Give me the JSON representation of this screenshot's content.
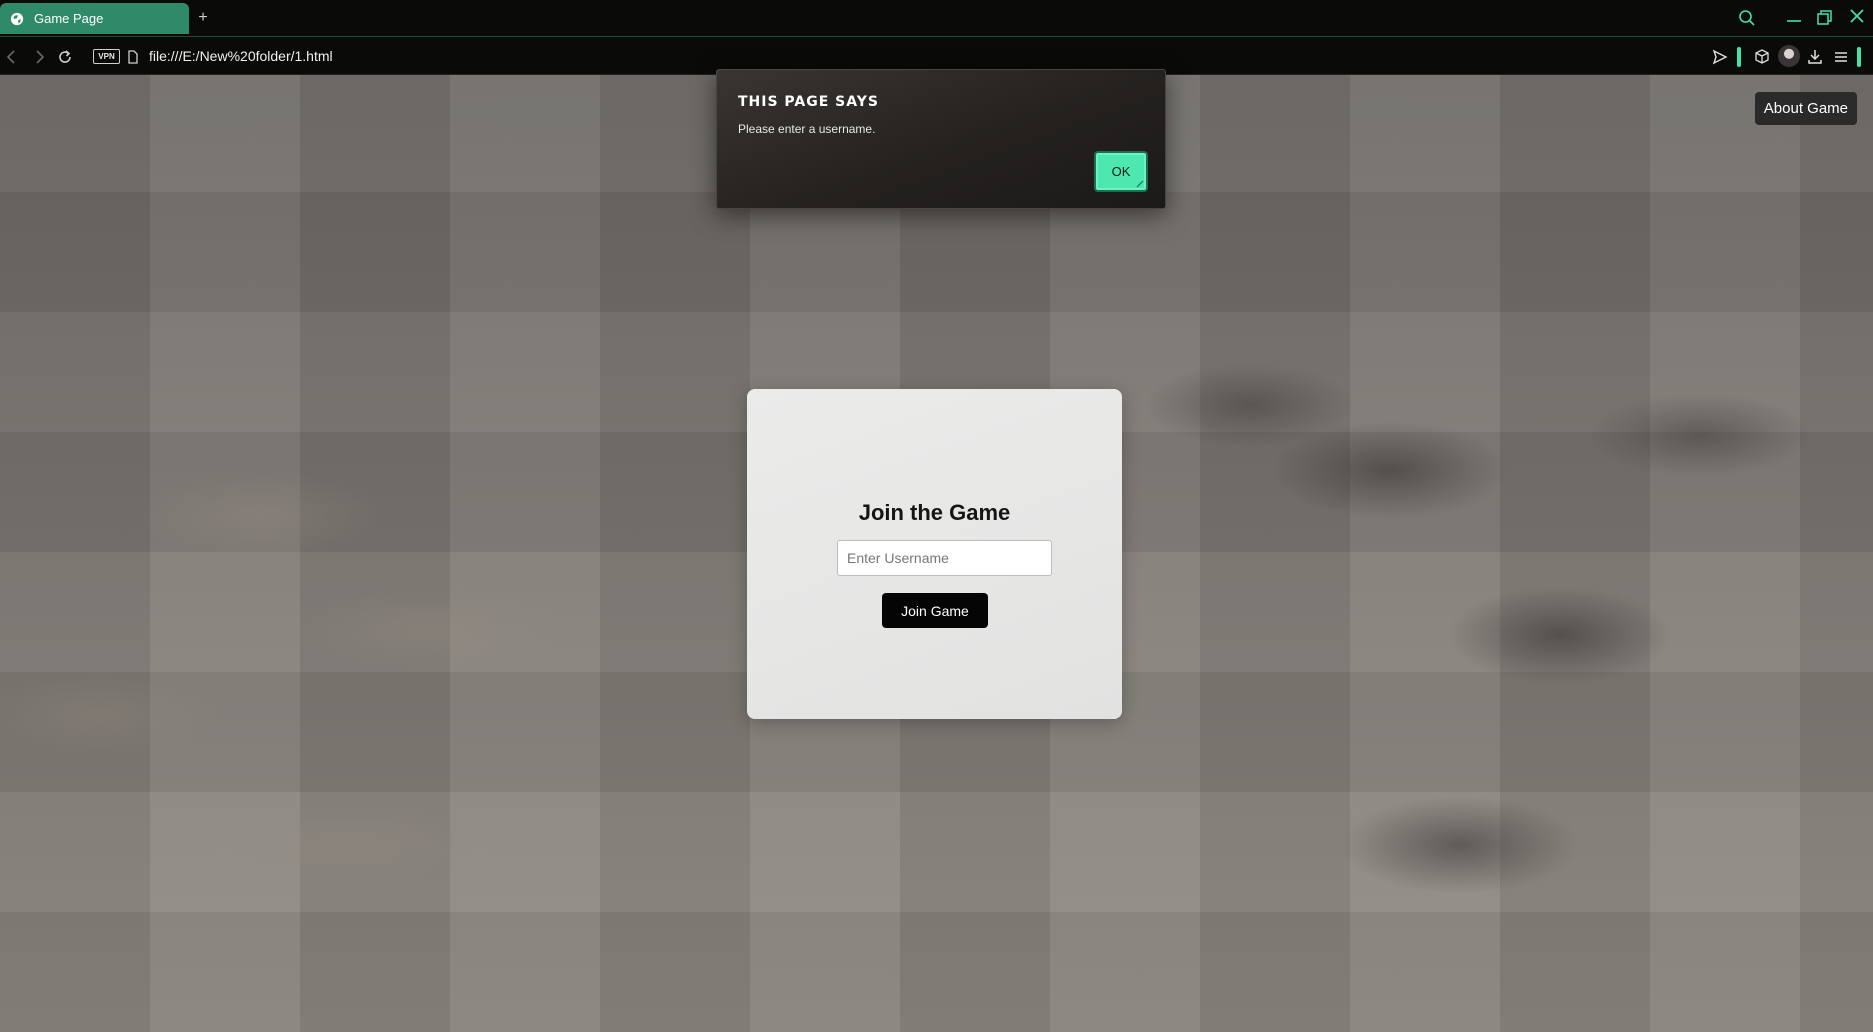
{
  "browser": {
    "tab_title": "Game Page",
    "new_tab_symbol": "+",
    "vpn_label": "VPN",
    "url": "file:///E:/New%20folder/1.html",
    "accent_color": "#43e2a6"
  },
  "page": {
    "about_button": "About Game",
    "join_card": {
      "title": "Join the Game",
      "username_placeholder": "Enter Username",
      "username_value": "",
      "join_button": "Join Game"
    }
  },
  "dialog": {
    "title": "THIS PAGE SAYS",
    "message": "Please enter a username.",
    "ok_button": "OK"
  }
}
